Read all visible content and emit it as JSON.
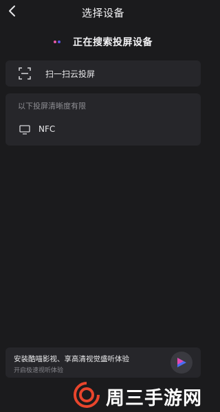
{
  "header": {
    "back_icon": "chevron-left-icon",
    "title": "选择设备"
  },
  "status": {
    "searching_text": "正在搜索投屏设备",
    "dot_colors": [
      "#e95aa8",
      "#5a55e6"
    ]
  },
  "scan": {
    "icon": "scan-icon",
    "label": "扫一扫云投屏"
  },
  "devices": {
    "limit_label": "以下投屏清晰度有限",
    "items": [
      {
        "icon": "tv-icon",
        "name": "NFC"
      }
    ]
  },
  "promo": {
    "title": "安装酷喵影视、享高清视觉盛听体验",
    "subtitle": "开启极速视听体验",
    "logo_icon": "app-logo-icon",
    "logo_colors": [
      "#e24ab0",
      "#4a6cf0"
    ]
  },
  "watermark": {
    "text": "周三手游网",
    "logo_color": "#e8452c"
  }
}
